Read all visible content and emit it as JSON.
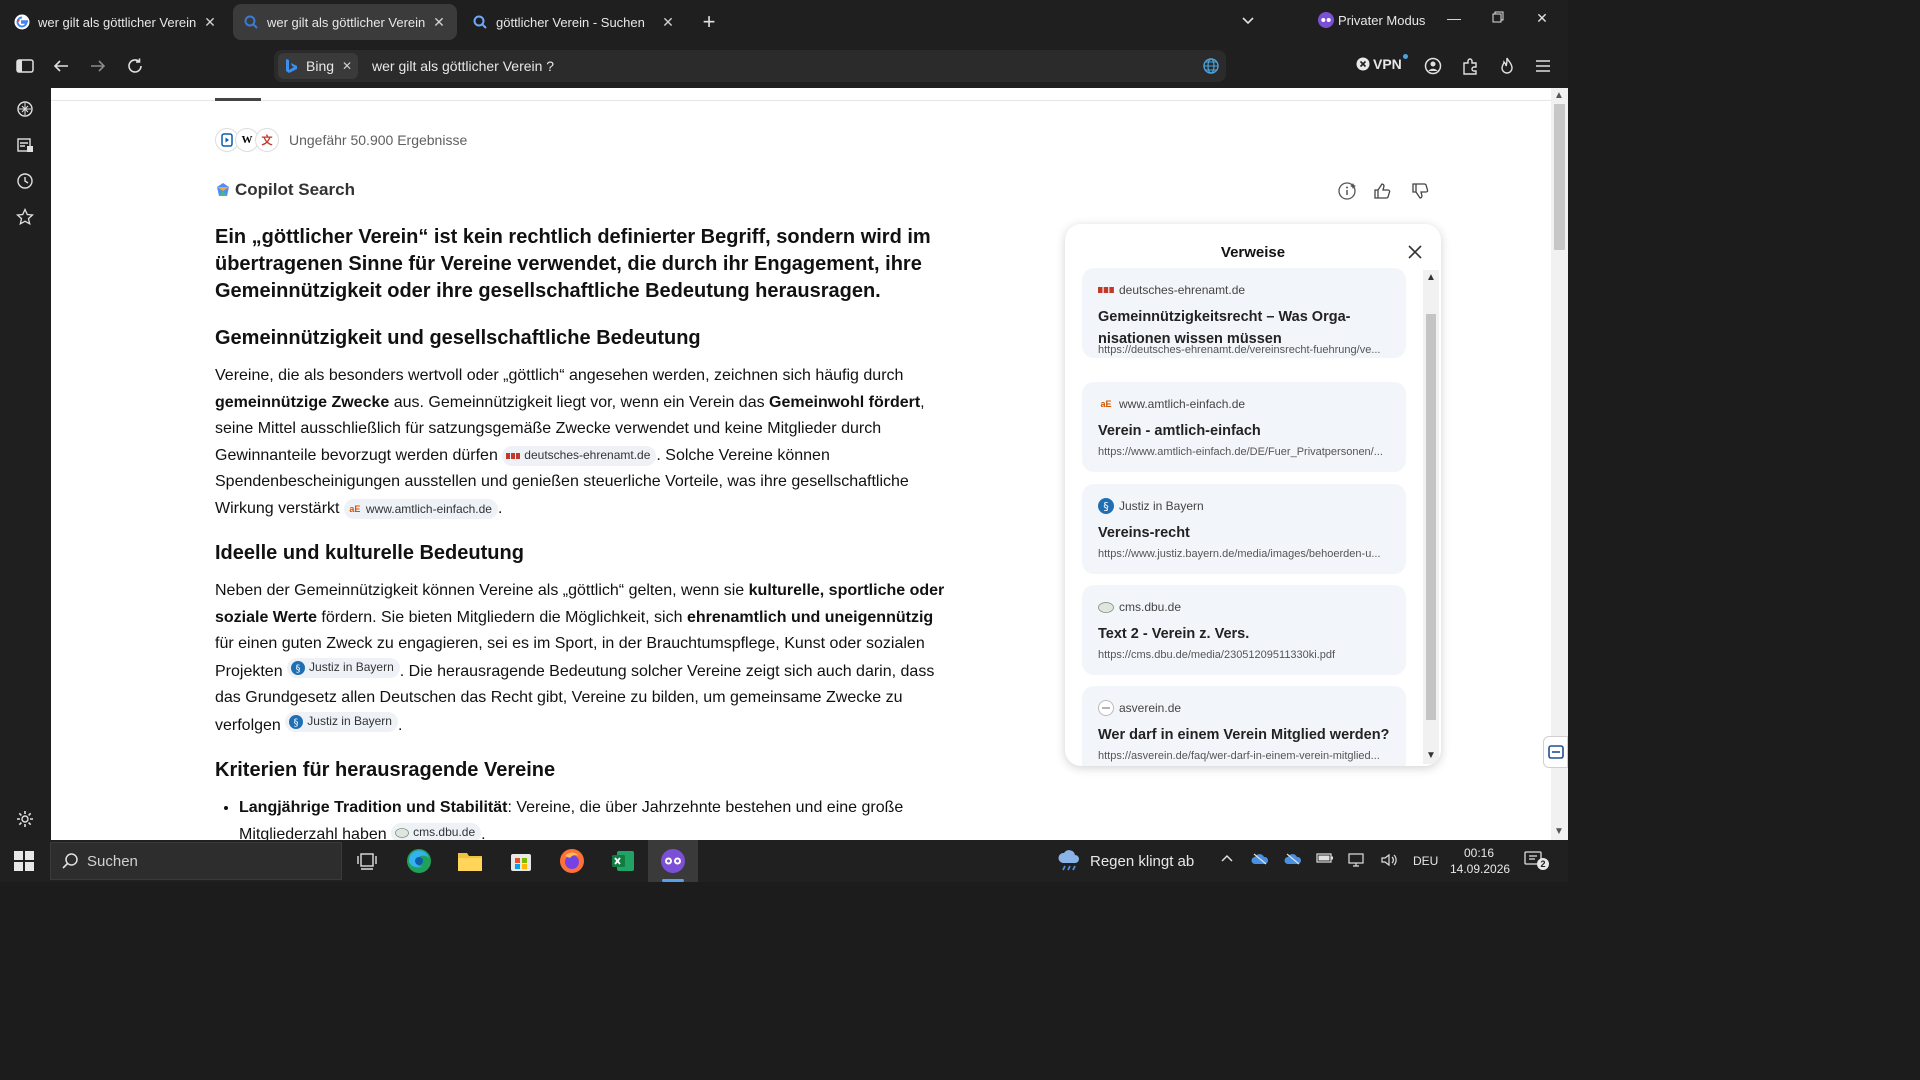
{
  "tabs": [
    {
      "title": "wer gilt als göttlicher Verein ? -",
      "icon": "google-icon"
    },
    {
      "title": "wer gilt als göttlicher Verein ? -",
      "icon": "bing-icon"
    },
    {
      "title": "göttlicher Verein - Suchen",
      "icon": "search-icon"
    }
  ],
  "window": {
    "private_label": "Privater Modus"
  },
  "address": {
    "engine_label": "Bing",
    "query": "wer gilt als göttlicher Verein ?"
  },
  "toolbar": {
    "vpn_label": "VPN"
  },
  "results": {
    "count_text": "Ungefähr 50.900 Ergebnisse",
    "source_badges": [
      "W",
      "文"
    ]
  },
  "copilot": {
    "title": "Copilot Search"
  },
  "answer": {
    "lead": "Ein „göttlicher Verein“ ist kein rechtlich definierter Begriff, sondern wird im übertragenen Sinne für Vereine verwendet, die durch ihr Engagement, ihre Gemeinnützigkeit oder ihre gesellschaftliche Bedeutung herausragen.",
    "s1": {
      "heading": "Gemeinnützigkeit und gesellschaftliche Bedeutung",
      "p1": "Vereine, die als besonders wertvoll oder „göttlich“ angesehen werden, zeichnen sich häufig durch ",
      "b1": "gemeinnützige Zwecke",
      "p2": " aus. Gemeinnützigkeit liegt vor, wenn ein Verein das ",
      "b2": "Gemeinwohl fördert",
      "p3": ", seine Mittel ausschließlich für satzungsgemäße Zwecke verwendet und keine Mitglieder durch Gewinnanteile bevorzugt werden dürfen ",
      "c1": "deutsches-ehrenamt.de",
      "p4": ". Solche Vereine können Spendenbescheinigungen ausstellen und genießen steuerliche Vorteile, was ihre gesellschaftliche Wirkung verstärkt ",
      "c2": "www.amtlich-einfach.de",
      "p5": "."
    },
    "s2": {
      "heading": "Ideelle und kulturelle Bedeutung",
      "p1": "Neben der Gemeinnützigkeit können Vereine als „göttlich“ gelten, wenn sie ",
      "b1": "kulturelle, sportliche oder soziale Werte",
      "p2": " fördern. Sie bieten Mitgliedern die Möglichkeit, sich ",
      "b2": "ehrenamtlich und uneigennützig",
      "p3": " für einen guten Zweck zu engagieren, sei es im Sport, in der Brauchtumspflege, Kunst oder sozialen Projekten ",
      "c1": "Justiz in Bayern",
      "p4": ". Die herausragende Bedeutung solcher Vereine zeigt sich auch darin, dass das Grundgesetz allen Deutschen das Recht gibt, Vereine zu bilden, um gemeinsame Zwecke zu verfolgen ",
      "c2": "Justiz in Bayern",
      "p5": "."
    },
    "s3": {
      "heading": "Kriterien für herausragende Vereine",
      "li1_bold": "Langjährige Tradition und Stabilität",
      "li1_text": ": Vereine, die über Jahrzehnte bestehen und eine große Mitgliederzahl haben ",
      "li1_cite": "cms.dbu.de",
      "li1_end": "."
    }
  },
  "references": {
    "title": "Verweise",
    "items": [
      {
        "site": "deutsches-ehrenamt.de",
        "title": "Gemeinnützigkeitsrecht – Was Orga-nisationen wissen müssen",
        "url": "https://deutsches-ehrenamt.de/vereinsrecht-fuehrung/ve..."
      },
      {
        "site": "www.amtlich-einfach.de",
        "title": "Verein - amtlich-einfach",
        "url": "https://www.amtlich-einfach.de/DE/Fuer_Privatpersonen/..."
      },
      {
        "site": "Justiz in Bayern",
        "title": "Vereins-recht",
        "url": "https://www.justiz.bayern.de/media/images/behoerden-u..."
      },
      {
        "site": "cms.dbu.de",
        "title": "Text 2 - Verein z. Vers.",
        "url": "https://cms.dbu.de/media/23051209511330ki.pdf"
      },
      {
        "site": "asverein.de",
        "title": "Wer darf in einem Verein Mitglied werden?",
        "url": "https://asverein.de/faq/wer-darf-in-einem-verein-mitglied..."
      }
    ]
  },
  "taskbar": {
    "search_label": "Suchen",
    "weather": "Regen klingt ab",
    "lang": "DEU",
    "time": "00:16",
    "date": "14.09.2026",
    "notifications": "2"
  },
  "colors": {
    "accent": "#0078d4",
    "private": "#7b4fd6"
  }
}
